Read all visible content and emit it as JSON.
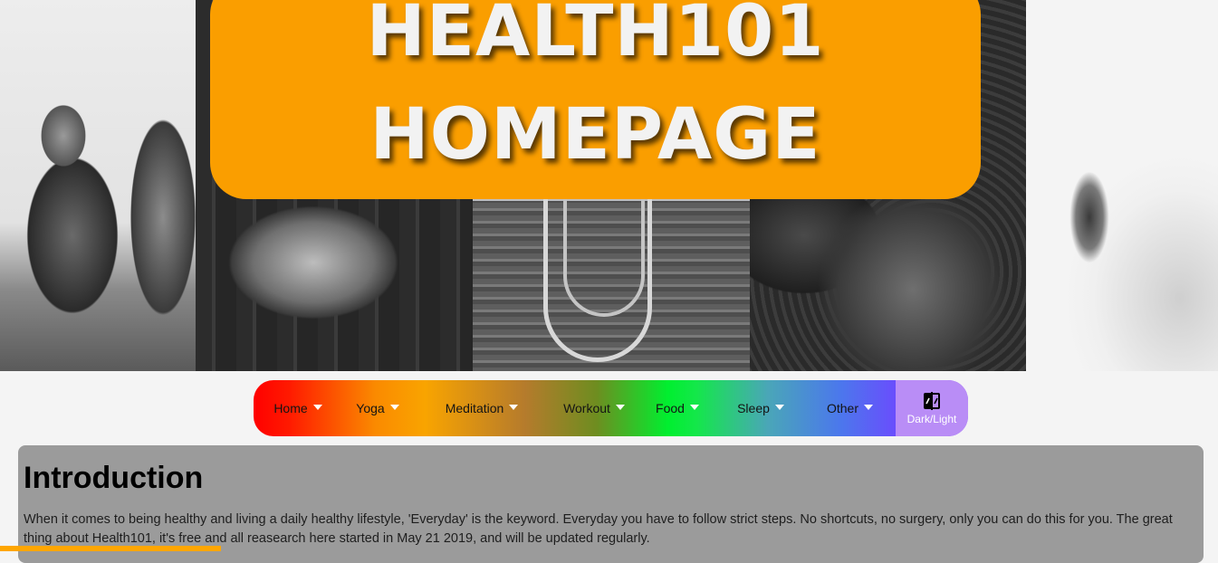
{
  "hero": {
    "title_line1": "HEALTH101",
    "title_line2": "HOMEPAGE"
  },
  "nav": {
    "items": [
      {
        "label": "Home"
      },
      {
        "label": "Yoga"
      },
      {
        "label": "Meditation"
      },
      {
        "label": "Workout"
      },
      {
        "label": "Food"
      },
      {
        "label": "Sleep"
      },
      {
        "label": "Other"
      }
    ],
    "theme_toggle_label": "Dark/Light"
  },
  "intro": {
    "heading": "Introduction",
    "body": "When it comes to being healthy and living a daily healthy lifestyle, 'Everyday' is the keyword. Everyday you have to follow strict steps. No shortcuts, no surgery, only you can do this for you. The great thing about Health101, it's free and all reasearch here started in May 21 2019, and will be updated regularly."
  },
  "colors": {
    "banner": "#fa9e00",
    "toggle_bg": "#b98df6",
    "card_bg": "#9b9b9b",
    "progress": "#ffa600"
  },
  "icons": {
    "dropdown": "caret-down-icon",
    "theme_toggle": "contrast-toggle-icon"
  }
}
